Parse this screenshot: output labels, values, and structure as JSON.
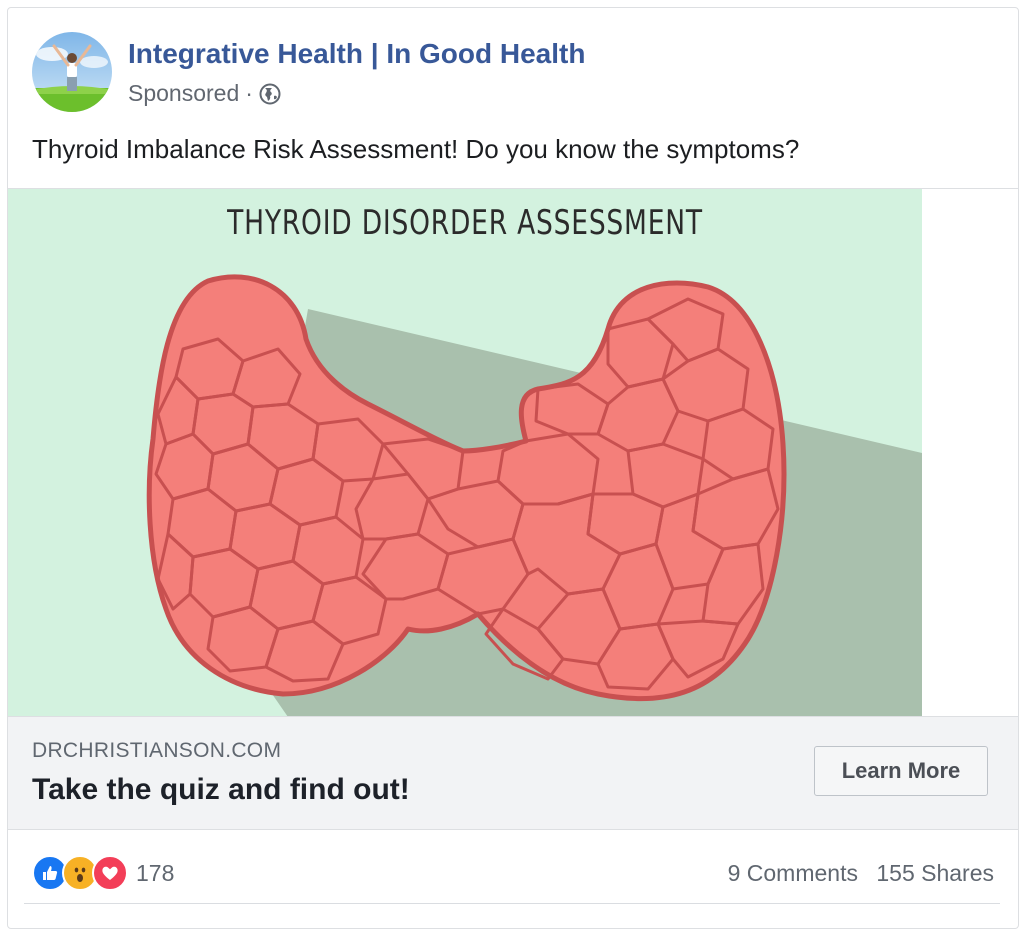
{
  "post": {
    "page_name": "Integrative Health | In Good Health",
    "sponsored_label": "Sponsored",
    "separator": "·",
    "privacy_icon": "globe-icon",
    "text": "Thyroid Imbalance Risk Assessment! Do you know the symptoms?"
  },
  "media": {
    "title": "Thyroid Disorder Assessment",
    "background_color": "#d3f2df",
    "shadow_color": "#a9c0ad",
    "gland_fill": "#f47f7a",
    "gland_stroke": "#c85050"
  },
  "link": {
    "domain": "DRCHRISTIANSON.COM",
    "headline": "Take the quiz and find out!",
    "cta_label": "Learn More"
  },
  "engagement": {
    "reaction_icons": [
      "like-icon",
      "wow-icon",
      "love-icon"
    ],
    "reaction_count": "178",
    "comments": "9 Comments",
    "shares": "155 Shares"
  },
  "colors": {
    "page_name": "#385898",
    "like": "#1877f2",
    "wow": "#f7b125",
    "love": "#f33e58"
  }
}
